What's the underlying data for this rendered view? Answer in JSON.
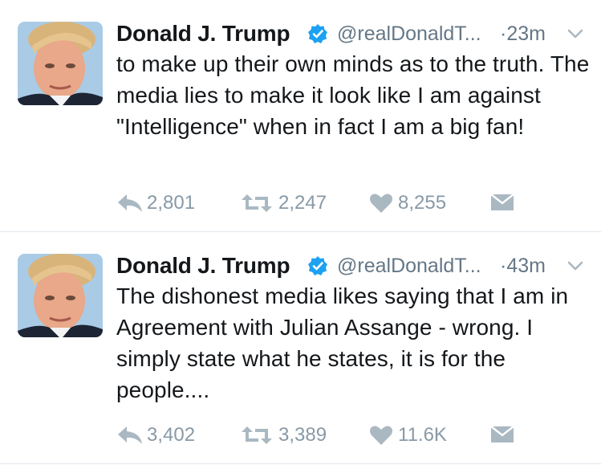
{
  "tweets": [
    {
      "name": "Donald J. Trump",
      "handle": "@realDonaldT...",
      "time": "·23m",
      "text": "to make up their own minds as to the truth. The media lies to make it look like I am against \"Intelligence\" when in fact I am a big fan!",
      "replies": "2,801",
      "retweets": "2,247",
      "likes": "8,255"
    },
    {
      "name": "Donald J. Trump",
      "handle": "@realDonaldT...",
      "time": "·43m",
      "text": "The dishonest media likes saying that I am in Agreement with Julian Assange - wrong. I simply state what he states, it is for the people....",
      "replies": "3,402",
      "retweets": "3,389",
      "likes": "11.6K"
    }
  ],
  "icons": {
    "verified": "verified-badge-icon",
    "more": "chevron-down-icon",
    "reply": "reply-icon",
    "retweet": "retweet-icon",
    "like": "heart-icon",
    "message": "direct-message-icon"
  },
  "colors": {
    "verified_blue": "#1da1f2",
    "meta_gray": "#657786",
    "action_gray": "#8899a6",
    "divider": "#e1e8ed"
  }
}
